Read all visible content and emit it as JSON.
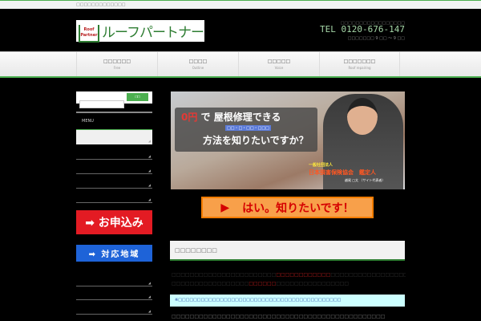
{
  "topbar": {
    "tagline": "□□□□□□□□□□□□□"
  },
  "header": {
    "logo_badge": "Roof Partner",
    "logo_text": "ルーフパートナー",
    "tel_note": "□□□□□□□□□□□□□□□□□",
    "tel": "TEL 0120-676-147",
    "hours": "□□□□□□□ 9 □□ ～ 9 □□"
  },
  "nav": [
    {
      "jp": "□□□□□□",
      "en": "Free"
    },
    {
      "jp": "□□□□",
      "en": "Outline"
    },
    {
      "jp": "□□□□□",
      "en": "Voice"
    },
    {
      "jp": "□□□□□□□",
      "en": "Roof repairing"
    }
  ],
  "sidebar": {
    "search_placeholder": "",
    "search_button": "□□",
    "menu_title": "MENU",
    "apply_label": "➡ お申込み",
    "area_label": "➡ 対応地域"
  },
  "banner": {
    "zero": "0円",
    "line1_rest": " で 屋根修理できる",
    "sub": "□□・□・□□・□□□",
    "line2": "方法を知りたいですか？",
    "org_small": "一般社団法人",
    "org": "日本損害保険協会　鑑定人",
    "person": "越尾 □太 （サイト代表者）"
  },
  "cta": {
    "arrow": "▶",
    "label": "はい。知りたいです！"
  },
  "content": {
    "section_heading": "□□□□□□□□",
    "para1": [
      {
        "t": "□□□□□□□□□□□□□□□□□□□□□□□",
        "red": false
      },
      {
        "t": "□□□□□□□□□□□□",
        "red": true
      },
      {
        "t": "□□□□□□□□□□□□□□□□□□□□□□□□□□□□□□□",
        "red": false
      }
    ],
    "para2": [
      {
        "t": "□□□□□□□□□□□□□□□□□",
        "red": false
      },
      {
        "t": "□□□□□□",
        "red": true
      },
      {
        "t": "□□□□□□□□□□□□□□□□",
        "red": false
      }
    ],
    "note": "※□□□□□□□□□□□□□□□□□□□□□□□□□□□□□□□□□□□□□□□□□□□",
    "bottom": "□□□□□□□□□□□□□□□□□□□□□□□□□□□□□□□□□□□□□□□□□□□□□□□"
  }
}
